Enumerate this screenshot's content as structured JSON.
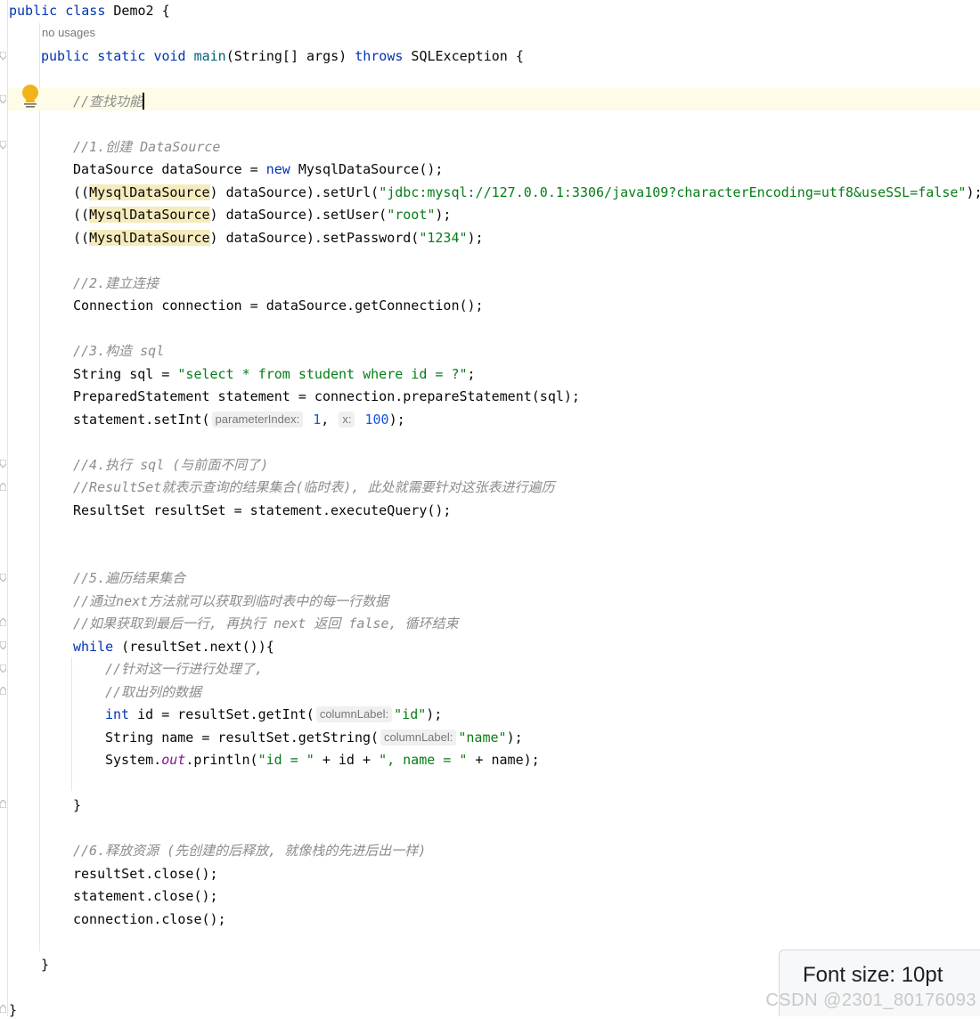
{
  "editor": {
    "usages_hint": "no usages",
    "inlay_hints": {
      "parameterIndex": "parameterIndex:",
      "x": "x:",
      "columnLabel": "columnLabel:"
    },
    "code": {
      "class_decl": {
        "kw1": "public",
        "kw2": "class",
        "name": "Demo2",
        "brace": " {"
      },
      "main_decl": {
        "kw1": "public",
        "kw2": "static",
        "kw3": "void",
        "method": "main",
        "params": "(String[] args) ",
        "kw4": "throws",
        "rest": " SQLException {"
      },
      "c_find": "//查找功能",
      "c1": "//1.创建 DataSource",
      "l_ds": {
        "a": "DataSource dataSource = ",
        "kw": "new",
        "b": " MysqlDataSource();"
      },
      "l_url": {
        "a": "((",
        "cls": "MysqlDataSource",
        "b": ") dataSource).setUrl(",
        "str": "\"jdbc:mysql://127.0.0.1:3306/java109?characterEncoding=utf8&useSSL=false\"",
        "c": ");"
      },
      "l_user": {
        "a": "((",
        "cls": "MysqlDataSource",
        "b": ") dataSource).setUser(",
        "str": "\"root\"",
        "c": ");"
      },
      "l_pw": {
        "a": "((",
        "cls": "MysqlDataSource",
        "b": ") dataSource).setPassword(",
        "str": "\"1234\"",
        "c": ");"
      },
      "c2": "//2.建立连接",
      "l_conn": "Connection connection = dataSource.getConnection();",
      "c3": "//3.构造 sql",
      "l_sql": {
        "a": "String sql = ",
        "str": "\"select * from student where id = ?\"",
        "c": ";"
      },
      "l_ps": "PreparedStatement statement = connection.prepareStatement(sql);",
      "l_setint": {
        "a": "statement.setInt(",
        "n1": "1",
        "sep": ", ",
        "n2": "100",
        "c": ");"
      },
      "c4": "//4.执行 sql (与前面不同了)",
      "c4b": "//ResultSet就表示查询的结果集合(临时表), 此处就需要针对这张表进行遍历",
      "l_rs": "ResultSet resultSet = statement.executeQuery();",
      "c5": "//5.遍历结果集合",
      "c5b": "//通过next方法就可以获取到临时表中的每一行数据",
      "c5c": "//如果获取到最后一行, 再执行 next 返回 false, 循环结束",
      "l_while": {
        "kw": "while",
        "rest": " (resultSet.next()){"
      },
      "c_row": "//针对这一行进行处理了,",
      "c_col": "//取出列的数据",
      "l_id": {
        "kw": "int",
        "a": " id = resultSet.getInt(",
        "str": "\"id\"",
        "c": ");"
      },
      "l_name": {
        "a": "String name = resultSet.getString(",
        "str": "\"name\"",
        "c": ");"
      },
      "l_print": {
        "a": "System.",
        "field": "out",
        "b": ".println(",
        "s1": "\"id = \"",
        "m1": " + id + ",
        "s2": "\", name = \"",
        "m2": " + name);"
      },
      "close_while": "}",
      "c6": "//6.释放资源 (先创建的后释放, 就像栈的先进后出一样)",
      "l_c1": "resultSet.close();",
      "l_c2": "statement.close();",
      "l_c3": "connection.close();",
      "close_main": "}",
      "close_class": "}"
    }
  },
  "tooltip": {
    "text": "Font size: 10pt"
  },
  "watermark": "CSDN @2301_80176093",
  "colors": {
    "keyword": "#0033b3",
    "string": "#067d17",
    "number": "#1750eb",
    "comment": "#8c8c8c",
    "method": "#00627a",
    "field": "#871094"
  },
  "icons": {
    "intention": "lightbulb-icon",
    "fold": "fold-marker-icon"
  }
}
